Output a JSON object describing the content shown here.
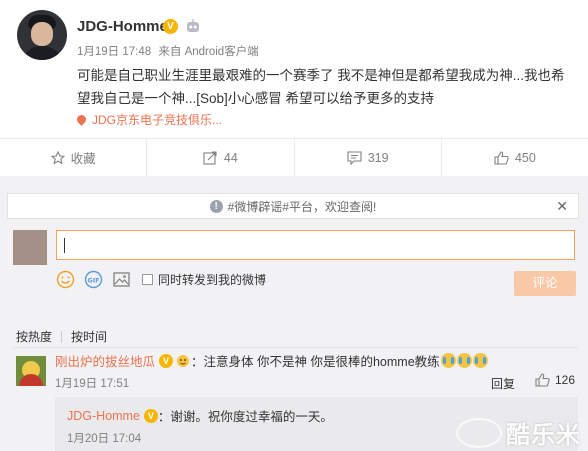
{
  "post": {
    "username": "JDG-Homme",
    "verified_badge": "V",
    "time": "1月19日 17:48",
    "source": "来自 Android客户端",
    "content": "可能是自己职业生涯里最艰难的一个赛季了 我不是神但是都希望我成为神...我也希望我自己是一个神...[Sob]小心感冒 希望可以给予更多的支持",
    "topic": "JDG京东电子竞技俱乐..."
  },
  "actions": {
    "favorite_label": "收藏",
    "forward_count": "44",
    "comment_count": "319",
    "like_count": "450"
  },
  "comment_box": {
    "notice": "#微博辟谣#平台，欢迎查阅!",
    "notice_close": "✕",
    "forward_label": "同时转发到我的微博",
    "submit_label": "评论"
  },
  "sort": {
    "hot": "按热度",
    "time": "按时间"
  },
  "comment": {
    "username": "刚出炉的拔丝地瓜",
    "verified_badge": "V",
    "text": "：注意身体 你不是神 你是很棒的homme教练",
    "time": "1月19日 17:51",
    "reply_label": "回复",
    "like_count": "126"
  },
  "reply": {
    "username": "JDG-Homme",
    "verified_badge": "V",
    "text": "：谢谢。祝你度过幸福的一天。",
    "time": "1月20日 17:04"
  },
  "watermark": {
    "text": "酷乐米"
  },
  "colors": {
    "accent": "#eb7350",
    "badge": "#f7b500",
    "input_border": "#f7a05d",
    "submit_bg": "#f9c8a7",
    "comment_bg": "#f2f2f5"
  }
}
